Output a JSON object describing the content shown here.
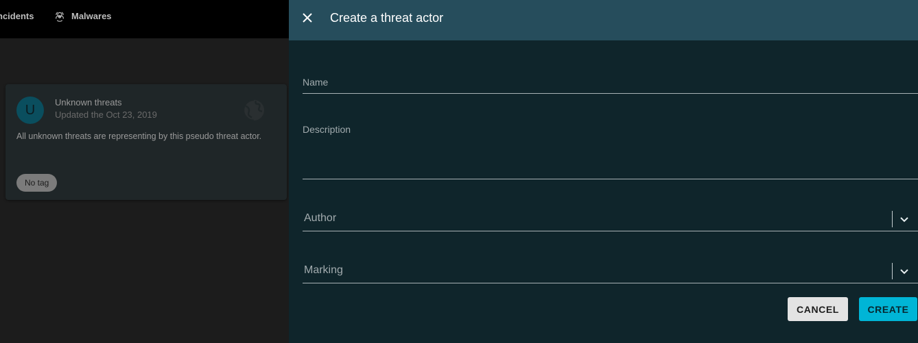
{
  "background": {
    "nav": {
      "incidents_label": "ncidents",
      "malwares_label": "Malwares",
      "malwares_icon": "biohazard-icon"
    },
    "card": {
      "avatar_letter": "U",
      "title": "Unknown threats",
      "updated": "Updated the Oct 23, 2019",
      "description": "All unknown threats are representing by this pseudo threat actor.",
      "tag": "No tag",
      "icon": "globe-icon"
    }
  },
  "drawer": {
    "title": "Create a threat actor",
    "close_icon": "close-icon",
    "fields": {
      "name_label": "Name",
      "description_label": "Description",
      "author_label": "Author",
      "marking_label": "Marking"
    },
    "buttons": {
      "cancel": "CANCEL",
      "create": "CREATE"
    }
  },
  "colors": {
    "drawer_bg": "#0f252b",
    "header_bg": "#264d5c",
    "accent": "#00b5d6",
    "avatar_bg": "#0a4e5e"
  }
}
